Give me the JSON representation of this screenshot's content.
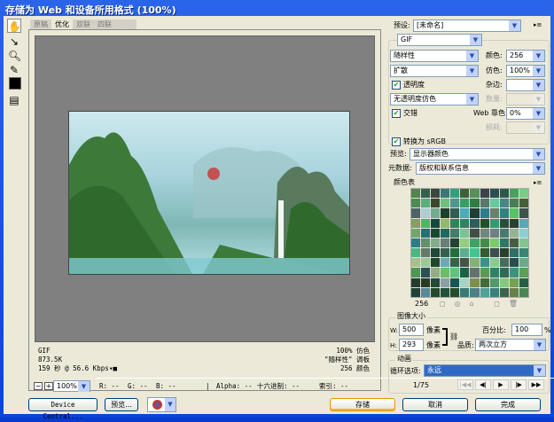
{
  "window": {
    "title": "存储为 Web 和设备所用格式 (100%)"
  },
  "tabs": [
    "原稿",
    "优化",
    "双联",
    "四联"
  ],
  "info": {
    "format": "GIF",
    "size": "873.5K",
    "time": "159 秒 @ 56.6 Kbps",
    "dither": "100% 仿色",
    "palette": "\"随样性\" 调板",
    "colors": "256 颜色"
  },
  "statusbar": {
    "zoom": "100%",
    "r": "R: --",
    "g": "G: --",
    "b": "B: --",
    "alpha": "Alpha: --",
    "hex": "十六进制: --",
    "index": "索引: --"
  },
  "buttons": {
    "device_central": "Device Central...",
    "preview": "预览...",
    "save": "存储",
    "cancel": "取消",
    "done": "完成"
  },
  "settings": {
    "preset_label": "预设:",
    "preset_value": "[未命名]",
    "format": "GIF",
    "reduction": "随样性",
    "colors_label": "颜色:",
    "colors_value": "256",
    "dither_algo": "扩散",
    "dither_label": "仿色:",
    "dither_value": "100%",
    "transparency": "透明度",
    "matte_label": "杂边:",
    "matte_value": "",
    "trans_dither": "无透明度仿色",
    "amount_label": "数量:",
    "interlaced": "交错",
    "websnap_label": "Web 靠色:",
    "websnap_value": "0%",
    "lossy_label": "损耗:",
    "convert_srgb": "转换为 sRGB",
    "preview_label": "预览:",
    "preview_value": "显示器颜色",
    "metadata_label": "元数据:",
    "metadata_value": "版权和联系信息"
  },
  "color_table": {
    "title": "颜色表",
    "count": "256"
  },
  "image_size": {
    "title": "图像大小",
    "w_label": "W:",
    "w": "500",
    "h_label": "H:",
    "h": "293",
    "unit": "像素",
    "percent_label": "百分比:",
    "percent": "100",
    "percent_unit": "%",
    "quality_label": "品质:",
    "quality": "两次立方"
  },
  "animation": {
    "title": "动画",
    "loop_label": "循环选项:",
    "loop_value": "永远",
    "frame": "1/75"
  }
}
